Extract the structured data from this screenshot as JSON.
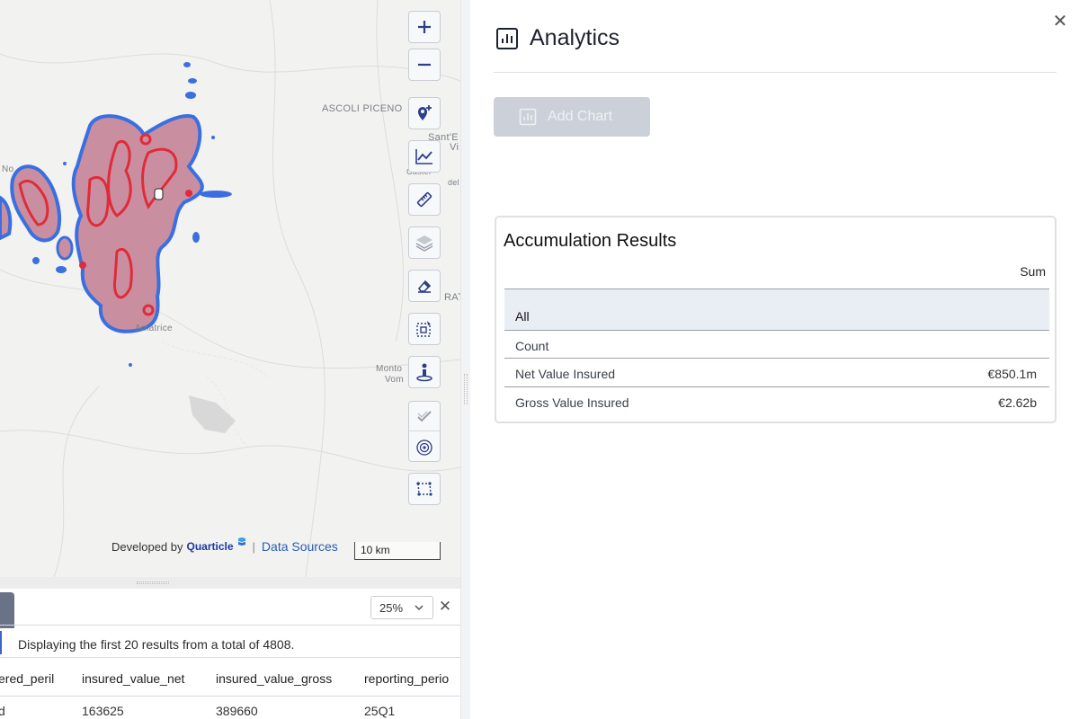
{
  "map": {
    "labels": {
      "ascoli": "ASCOLI PICENO",
      "saint": "Sant'E",
      "vi": "Vi",
      "castel": "Castel",
      "castel2": "del",
      "no": "No",
      "amatrice": "Amatrice",
      "monto": "Monto",
      "vom": "Vom",
      "rat": "RAT"
    },
    "tools": {
      "zoom_in": "zoom-in",
      "zoom_out": "zoom-out",
      "add_location": "map-pin-plus-icon",
      "chart": "line-chart-icon",
      "measure": "ruler-icon",
      "layers": "layers-icon",
      "erase": "eraser-icon",
      "select": "selection-icon",
      "person": "person-pin-icon",
      "check": "check-icon",
      "target": "target-icon",
      "polygon": "polygon-select-icon"
    },
    "attribution": {
      "developed_by": "Developed by",
      "brand": "Quarticle",
      "data_sources": "Data Sources"
    },
    "scale": "10 km",
    "heat_colors": {
      "fill": "#c98fa0",
      "edge": "#3b6fe0",
      "core": "#e02b3a"
    }
  },
  "table_pane": {
    "zoom": "25%",
    "close": "✕",
    "info": "Displaying the first 20 results from a total of 4808.",
    "columns": [
      "ered_peril",
      "insured_value_net",
      "insured_value_gross",
      "reporting_perio"
    ],
    "rows": [
      [
        "d",
        "163625",
        "389660",
        "25Q1"
      ]
    ]
  },
  "analytics": {
    "title": "Analytics",
    "close": "✕",
    "add_chart": "Add Chart",
    "results": {
      "title": "Accumulation Results",
      "sum_header": "Sum",
      "all_label": "All",
      "rows": [
        {
          "label": "Count",
          "value": ""
        },
        {
          "label": "Net Value Insured",
          "value": "€850.1m"
        },
        {
          "label": "Gross Value Insured",
          "value": "€2.62b"
        }
      ]
    },
    "accent": "#2d3e8a"
  }
}
